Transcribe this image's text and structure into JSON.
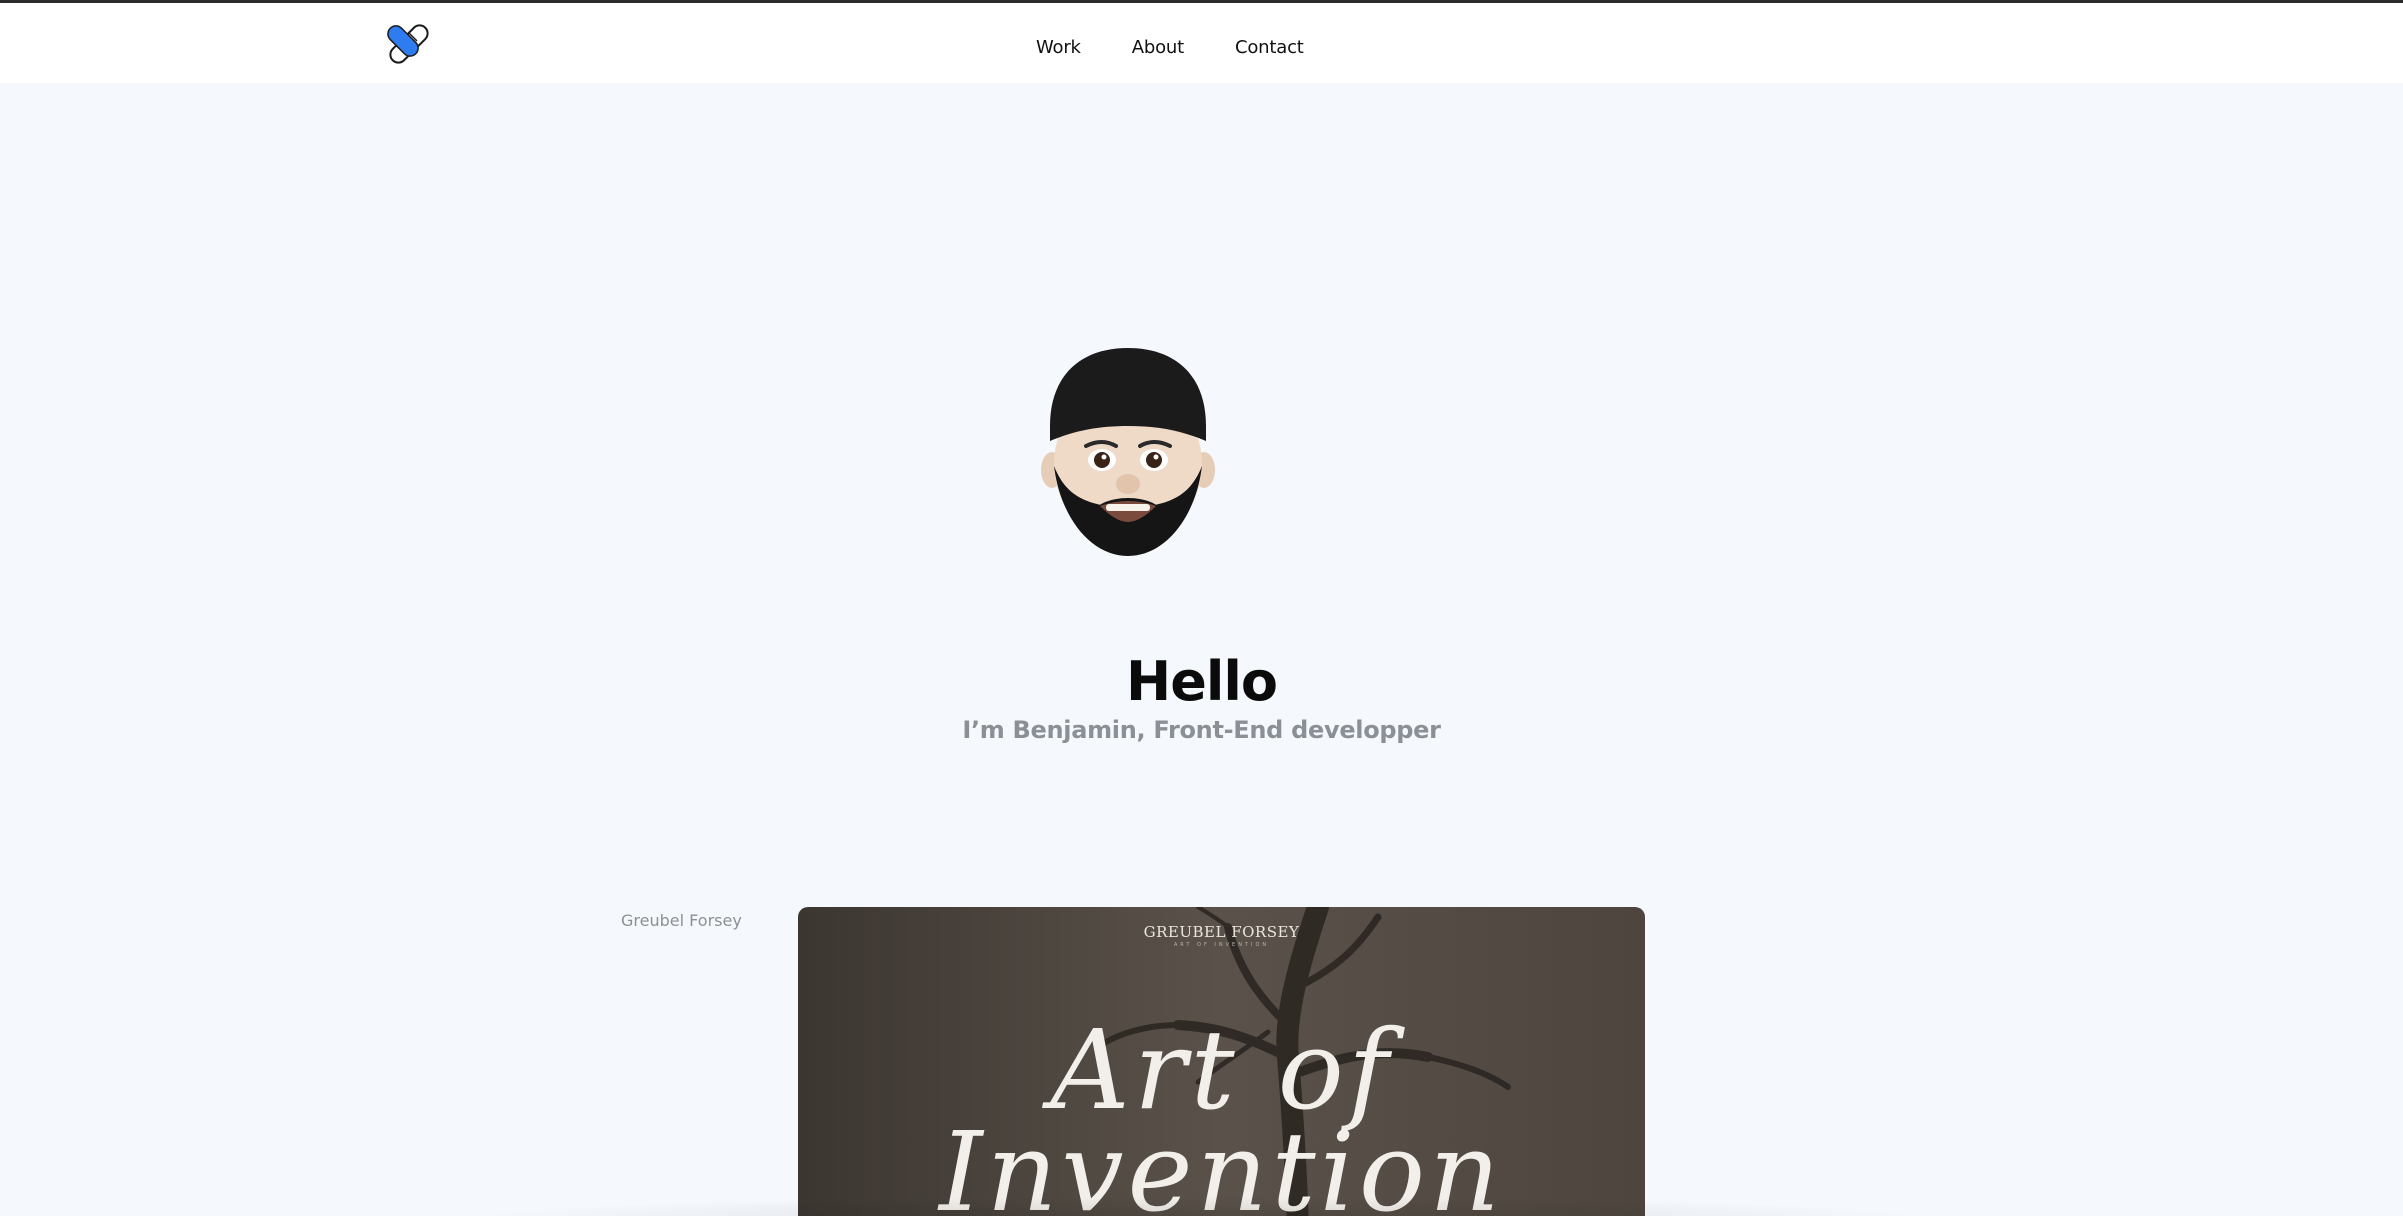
{
  "nav": {
    "items": [
      "Work",
      "About",
      "Contact"
    ]
  },
  "hero": {
    "title": "Hello",
    "subtitle": "I’m Benjamin, Front-End developper"
  },
  "projects": [
    {
      "label": "Greubel Forsey",
      "preview": {
        "brand": "GREUBEL FORSEY",
        "brand_sub": "ART OF INVENTION",
        "script_line1": "Art of",
        "script_line2": "Invention"
      }
    }
  ],
  "colors": {
    "accent": "#2f7bf0",
    "background": "#f5f9fd",
    "muted": "#8b9097"
  }
}
